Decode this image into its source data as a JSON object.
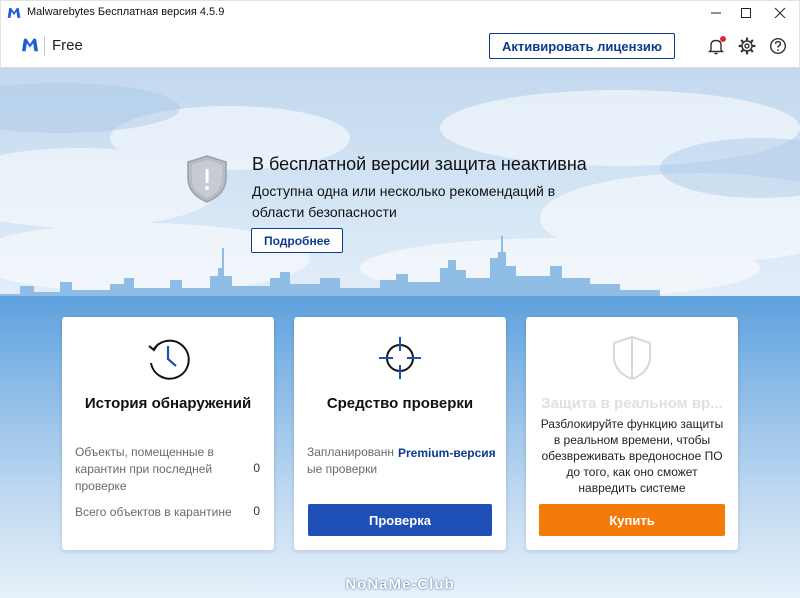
{
  "window": {
    "title": "Malwarebytes Бесплатная версия  4.5.9"
  },
  "header": {
    "edition": "Free",
    "activate_label": "Активировать лицензию"
  },
  "hero": {
    "title": "В бесплатной версии защита неактивна",
    "subtitle": "Доступна одна или несколько рекомендаций в области безопасности",
    "details_label": "Подробнее"
  },
  "cards": {
    "history": {
      "title": "История обнаружений",
      "stats": [
        {
          "label": "Объекты, помещенные в карантин при последней проверке",
          "value": "0"
        },
        {
          "label": "Всего объектов в карантине",
          "value": "0"
        }
      ]
    },
    "scanner": {
      "title": "Средство проверки",
      "scheduled_label": "Запланированные проверки",
      "premium_label": "Premium-версия",
      "scan_label": "Проверка"
    },
    "realtime": {
      "title": "Защита в реальном вр...",
      "description": "Разблокируйте функцию защиты в реальном времени, чтобы обезвреживать вредоносное ПО до того, как оно сможет навредить системе",
      "buy_label": "Купить"
    }
  },
  "watermark": "NoNaMe-Club",
  "colors": {
    "brand_blue": "#0d3b8f",
    "scan_button": "#1e4fb7",
    "buy_button": "#f47b0b",
    "notification_dot": "#e32636"
  }
}
